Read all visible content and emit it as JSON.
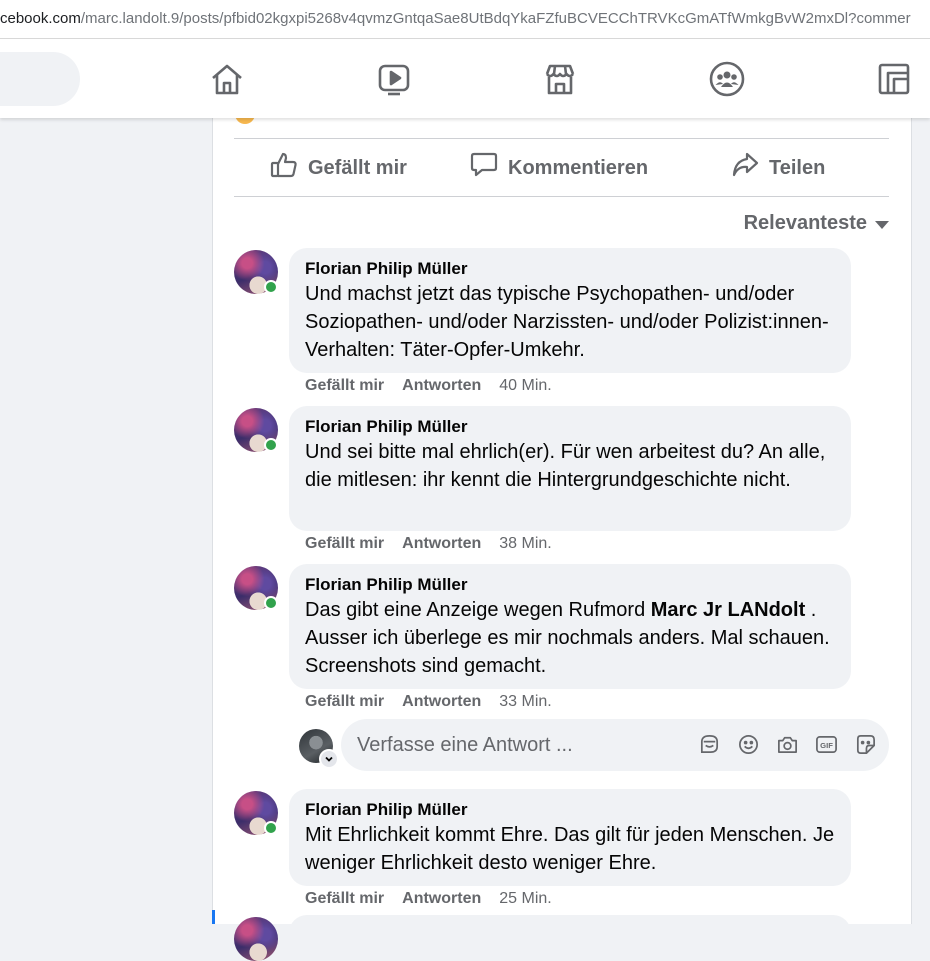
{
  "url": {
    "host": "cebook.com",
    "path": "/marc.landolt.9/posts/pfbid02kgxpi5268v4qvmzGntqaSae8UtBdqYkaFZfuBCVECChTRVKcGmATfWmkgBvW2mxDl?commer"
  },
  "nav": {
    "icons": [
      "home-icon",
      "watch-icon",
      "marketplace-icon",
      "groups-icon",
      "gaming-icon"
    ]
  },
  "post_actions": {
    "like": "Gefällt mir",
    "comment": "Kommentieren",
    "share": "Teilen"
  },
  "sort": {
    "label": "Relevanteste"
  },
  "comments": [
    {
      "author": "Florian Philip Müller",
      "text": "Und machst jetzt das typische Psychopathen- und/oder Soziopathen- und/oder Narzissten- und/oder Polizist:innen-Verhalten: Täter-Opfer-Umkehr.",
      "like": "Gefällt mir",
      "reply": "Antworten",
      "time": "40 Min."
    },
    {
      "author": "Florian Philip Müller",
      "text": "Und sei bitte mal ehrlich(er). Für wen arbeitest du? An alle, die mitlesen: ihr kennt die Hintergrundgeschichte nicht.",
      "like": "Gefällt mir",
      "reply": "Antworten",
      "time": "38 Min."
    },
    {
      "author": "Florian Philip Müller",
      "text_before": "Das gibt eine Anzeige wegen Rufmord ",
      "mention": "Marc Jr LANdolt",
      "text_after": " . Ausser ich überlege es mir nochmals anders. Mal schauen. Screenshots sind gemacht.",
      "like": "Gefällt mir",
      "reply": "Antworten",
      "time": "33 Min."
    },
    {
      "author": "Florian Philip Müller",
      "text": "Mit Ehrlichkeit kommt Ehre. Das gilt für jeden Menschen. Je weniger Ehrlichkeit desto weniger Ehre.",
      "like": "Gefällt mir",
      "reply": "Antworten",
      "time": "25 Min."
    }
  ],
  "reply_box": {
    "placeholder": "Verfasse eine Antwort ...",
    "icons": [
      "avatar-sticker-icon",
      "emoji-icon",
      "camera-icon",
      "gif-icon",
      "sticker-icon"
    ]
  }
}
